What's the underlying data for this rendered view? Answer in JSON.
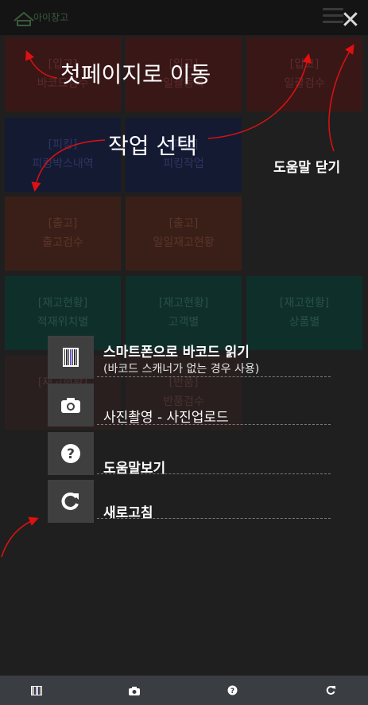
{
  "header": {
    "logo_text": "아이창고"
  },
  "tiles": [
    {
      "line1": "[입고]",
      "line2": "바코드검수"
    },
    {
      "line1": "[입고]",
      "line2": "일괄등록"
    },
    {
      "line1": "[입고]",
      "line2": "일괄검수"
    },
    {
      "line1": "[피킹]",
      "line2": "피킹박스내역"
    },
    {
      "line1": "[피킹]",
      "line2": "피킹작업"
    },
    {
      "line1": "[출고]",
      "line2": "출고검수"
    },
    {
      "line1": "[출고]",
      "line2": "일일재고현황"
    },
    {
      "line1": "[재고현황]",
      "line2": "적재위치별"
    },
    {
      "line1": "[재고현황]",
      "line2": "고객별"
    },
    {
      "line1": "[재고현황]",
      "line2": "상품별"
    },
    {
      "line1": "[재고현황]",
      "line2": ""
    },
    {
      "line1": "[반품]",
      "line2": "반품검수"
    }
  ],
  "annotations": {
    "first_page": "첫페이지로 이동",
    "select_task": "작업 선택",
    "close_help": "도움말 닫기"
  },
  "menu": {
    "barcode_title": "스마트폰으로 바코드 읽기",
    "barcode_sub": "(바코드 스캐너가 없는 경우 사용)",
    "photo_title": "사진촬영 - 사진업로드",
    "help_title": "도움말보기",
    "refresh_title": "새로고침"
  },
  "icons": {
    "close": "close-icon",
    "barcode": "barcode-icon",
    "camera": "camera-icon",
    "help": "help-icon",
    "refresh": "refresh-icon"
  },
  "colors": {
    "arrow": "#e01010",
    "panel": "#1f1f1f",
    "icon_bg": "#3f3f3f"
  }
}
